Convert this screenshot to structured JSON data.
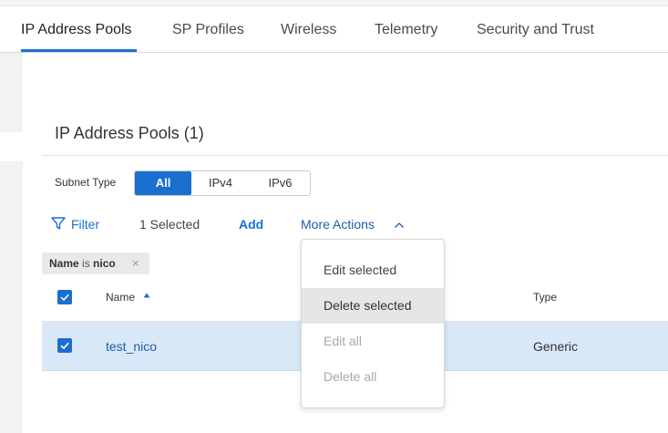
{
  "tabs": [
    {
      "label": "IP Address Pools",
      "active": true
    },
    {
      "label": "SP Profiles"
    },
    {
      "label": "Wireless"
    },
    {
      "label": "Telemetry"
    },
    {
      "label": "Security and Trust"
    }
  ],
  "panel": {
    "title": "IP Address Pools (1)"
  },
  "subnet": {
    "label": "Subnet Type",
    "options": [
      "All",
      "IPv4",
      "IPv6"
    ],
    "selected": "All"
  },
  "toolbar": {
    "filter_label": "Filter",
    "selected_count": "1 Selected",
    "add_label": "Add",
    "more_actions_label": "More Actions"
  },
  "filter_chip": {
    "field": "Name",
    "operator": "is",
    "value": "nico",
    "close": "×"
  },
  "table": {
    "columns": [
      "Name",
      "Type"
    ],
    "rows": [
      {
        "name": "test_nico",
        "type": "Generic",
        "selected": true
      }
    ]
  },
  "menu": {
    "items": [
      {
        "label": "Edit selected",
        "state": "enabled"
      },
      {
        "label": "Delete selected",
        "state": "hover"
      },
      {
        "label": "Edit all",
        "state": "disabled"
      },
      {
        "label": "Delete all",
        "state": "disabled"
      }
    ]
  },
  "colors": {
    "accent": "#1a6fcf",
    "row_selected": "#d9e8f7",
    "link": "#1a5fa8"
  },
  "icons": {
    "filter": "filter-icon",
    "sort": "sort-ascending-icon",
    "chevron": "chevron-up-icon",
    "checkbox": "checkmark-icon"
  }
}
